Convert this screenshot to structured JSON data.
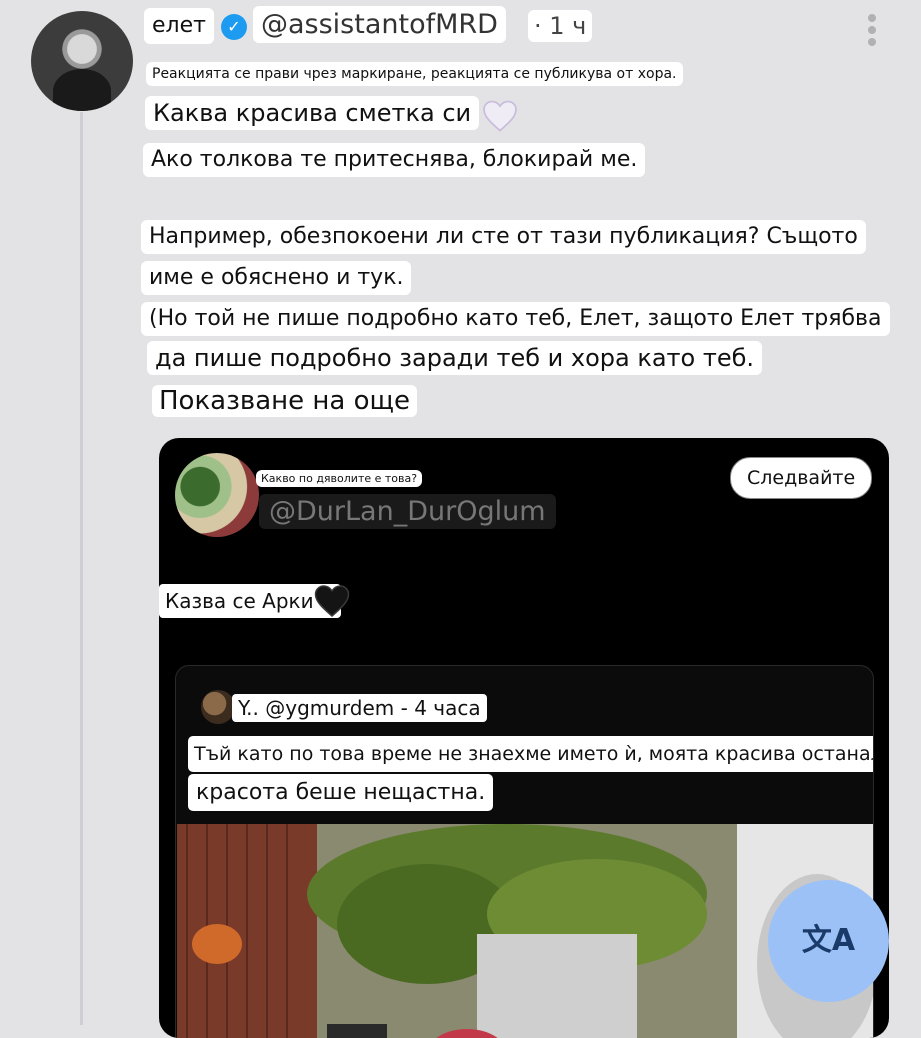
{
  "post": {
    "author_name": "елет",
    "handle": "@assistantofMRD",
    "time": "· 1 ч",
    "notice": "Реакцията се прави чрез маркиране, реакцията се публикува от хора.",
    "line1": "Каква красива сметка си",
    "line2": "Ако толкова те притеснява, блокирай ме.",
    "para3_a": "Например, обезпокоени ли сте от тази публикация? Същото",
    "para3_b": "име е обяснено и тук.",
    "para4_a": "(Но той не пише подробно като теб, Елет, защото Елет трябва",
    "para4_b": "да пише подробно заради теб и хора като теб.",
    "show_more": "Показване на още"
  },
  "embedded": {
    "question": "Какво по дяволите е това?",
    "handle": "@DurLan_DurOglum",
    "follow_label": "Следвайте",
    "text": "Казва се Арки :)",
    "quote": {
      "handle_line": "Y.. @ygmurdem - 4 часа",
      "line1": "Тъй като по това време не знаехме името ѝ, моята красива останала",
      "line2": "красота беше нещастна."
    }
  },
  "fab": {
    "icon": "translate-icon",
    "glyph": "文A"
  },
  "colors": {
    "background": "#e3e3e5",
    "verified": "#1d9bf0",
    "fab": "#9cc1f7",
    "card": "#000000"
  }
}
